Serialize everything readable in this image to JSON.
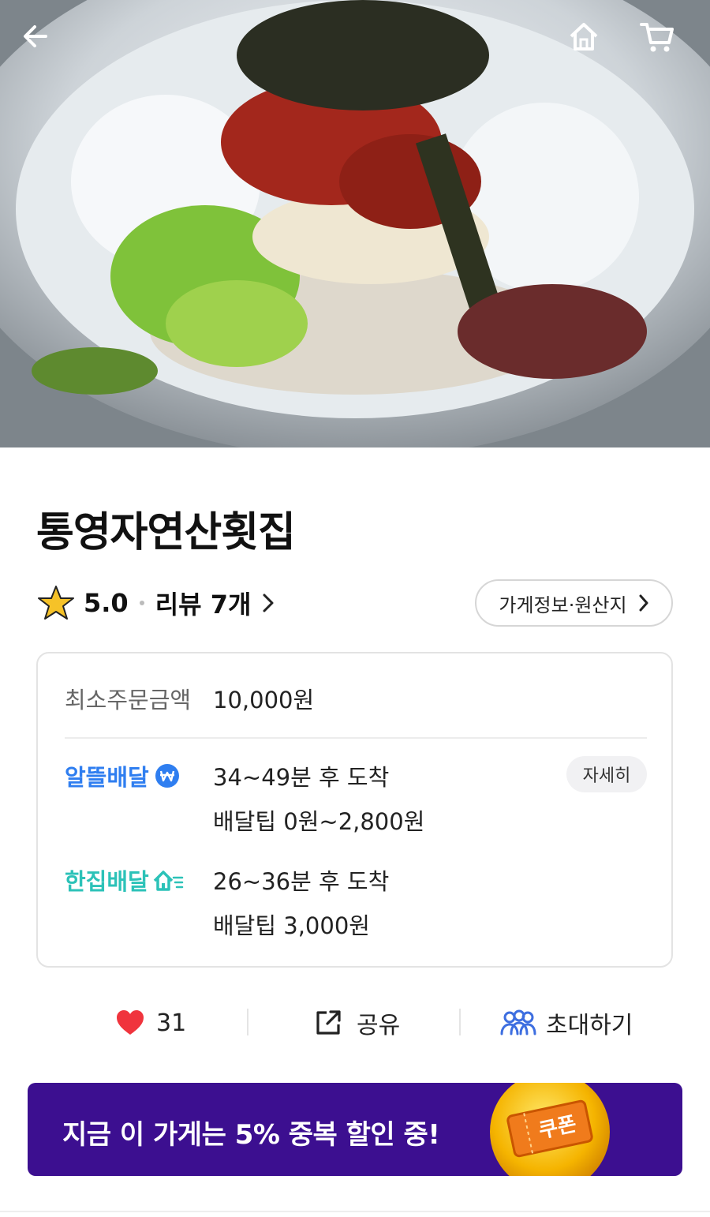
{
  "header": {
    "back_icon": "arrow-left-icon",
    "home_icon": "home-icon",
    "cart_icon": "cart-icon"
  },
  "hero": {
    "image": "bowl-of-cold-raw-fish-noodles-photo"
  },
  "store": {
    "name": "통영자연산횟집",
    "rating": "5.0",
    "reviews_label": "리뷰 7개",
    "info_button": "가게정보·원산지"
  },
  "delivery": {
    "min_order_label": "최소주문금액",
    "min_order_value": "10,000원",
    "options": [
      {
        "name": "알뜰배달",
        "arrival": "34~49분 후 도착",
        "tip": "배달팁 0원~2,800원",
        "color": "#2f7ef0",
        "icon": "won-badge-icon"
      },
      {
        "name": "한집배달",
        "arrival": "26~36분 후 도착",
        "tip": "배달팁 3,000원",
        "color": "#2cc2b8",
        "icon": "fast-house-icon"
      }
    ],
    "detail_button": "자세히"
  },
  "actions": {
    "like_count": "31",
    "share_label": "공유",
    "invite_label": "초대하기"
  },
  "banner": {
    "text": "지금 이 가게는 5% 중복 할인 중!",
    "coupon_label": "쿠폰",
    "color": "#3c0f90"
  }
}
